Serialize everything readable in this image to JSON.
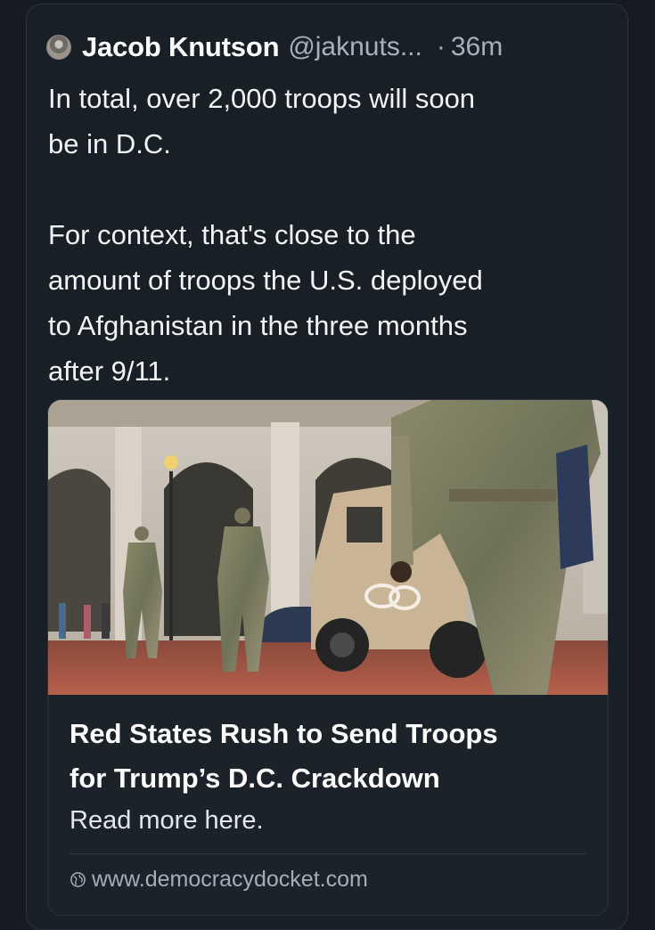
{
  "post": {
    "author_name": "Jacob Knutson",
    "author_handle": "@jaknuts...",
    "separator": "·",
    "time_ago": "36m",
    "text_lines_1": [
      "In total, over 2,000 troops will soon",
      "be in D.C."
    ],
    "text_lines_2": [
      "For context, that's close to the",
      "amount of troops the U.S. deployed",
      "to Afghanistan in the three months",
      "after 9/11."
    ]
  },
  "link_card": {
    "title_lines": [
      "Red States Rush to Send Troops",
      "for Trump’s D.C. Crackdown"
    ],
    "description": "Read more here.",
    "domain": "www.democracydocket.com",
    "image_icon": "news-photo"
  },
  "colors": {
    "background": "#161b22",
    "text": "#f2f4f5",
    "muted": "#a8b0ba"
  }
}
